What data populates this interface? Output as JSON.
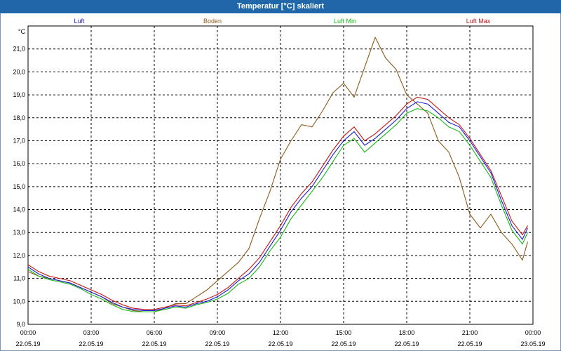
{
  "chart_data": {
    "type": "line",
    "title": "Temperatur [°C] skaliert",
    "ylabel": "°C",
    "ylim": [
      9.0,
      22.0
    ],
    "yticks": [
      {
        "value": 9.0,
        "label": "9,0"
      },
      {
        "value": 10.0,
        "label": "10,0"
      },
      {
        "value": 11.0,
        "label": "11,0"
      },
      {
        "value": 12.0,
        "label": "12,0"
      },
      {
        "value": 13.0,
        "label": "13,0"
      },
      {
        "value": 14.0,
        "label": "14,0"
      },
      {
        "value": 15.0,
        "label": "15,0"
      },
      {
        "value": 16.0,
        "label": "16,0"
      },
      {
        "value": 17.0,
        "label": "17,0"
      },
      {
        "value": 18.0,
        "label": "18,0"
      },
      {
        "value": 19.0,
        "label": "19,0"
      },
      {
        "value": 20.0,
        "label": "20,0"
      },
      {
        "value": 21.0,
        "label": "21,0"
      }
    ],
    "xlim": [
      0,
      24
    ],
    "xticks": [
      {
        "value": 0,
        "time": "00:00",
        "date": "22.05.19"
      },
      {
        "value": 3,
        "time": "03:00",
        "date": "22.05.19"
      },
      {
        "value": 6,
        "time": "06:00",
        "date": "22.05.19"
      },
      {
        "value": 9,
        "time": "09:00",
        "date": "22.05.19"
      },
      {
        "value": 12,
        "time": "12:00",
        "date": "22.05.19"
      },
      {
        "value": 15,
        "time": "15:00",
        "date": "22.05.19"
      },
      {
        "value": 18,
        "time": "18:00",
        "date": "22.05.19"
      },
      {
        "value": 21,
        "time": "21:00",
        "date": "22.05.19"
      },
      {
        "value": 24,
        "time": "00:00",
        "date": "23.05.19"
      }
    ],
    "grid": true,
    "legend_position": "top",
    "x": [
      0,
      0.5,
      1,
      1.5,
      2,
      2.5,
      3,
      3.5,
      4,
      4.5,
      5,
      5.5,
      6,
      6.5,
      7,
      7.5,
      8,
      8.5,
      9,
      9.5,
      10,
      10.5,
      11,
      11.5,
      12,
      12.5,
      13,
      13.5,
      14,
      14.5,
      15,
      15.5,
      16,
      16.5,
      17,
      17.5,
      18,
      18.5,
      19,
      19.5,
      20,
      20.5,
      21,
      21.5,
      22,
      22.5,
      23,
      23.5,
      23.75
    ],
    "series": [
      {
        "name": "Luft",
        "color": "#1a1ad8",
        "values": [
          11.5,
          11.2,
          11.0,
          10.9,
          10.8,
          10.6,
          10.4,
          10.2,
          9.95,
          9.75,
          9.65,
          9.6,
          9.6,
          9.7,
          9.8,
          9.75,
          9.9,
          10.0,
          10.2,
          10.5,
          10.9,
          11.2,
          11.7,
          12.4,
          13.1,
          13.9,
          14.5,
          15.0,
          15.7,
          16.4,
          17.0,
          17.4,
          16.8,
          17.1,
          17.5,
          17.9,
          18.4,
          18.7,
          18.6,
          18.2,
          17.8,
          17.6,
          17.0,
          16.3,
          15.6,
          14.4,
          13.3,
          12.7,
          13.2
        ]
      },
      {
        "name": "Boden",
        "color": "#8b5a1a",
        "values": [
          11.3,
          11.1,
          11.0,
          10.9,
          10.8,
          10.6,
          10.4,
          10.2,
          9.9,
          9.75,
          9.6,
          9.55,
          9.55,
          9.7,
          9.9,
          9.9,
          10.2,
          10.5,
          10.9,
          11.3,
          11.7,
          12.3,
          13.6,
          14.8,
          16.2,
          17.0,
          17.7,
          17.6,
          18.3,
          19.1,
          19.5,
          18.9,
          20.2,
          21.5,
          20.6,
          20.1,
          19.0,
          18.6,
          18.2,
          17.0,
          16.5,
          15.4,
          13.8,
          13.2,
          13.8,
          13.0,
          12.5,
          11.8,
          12.6
        ]
      },
      {
        "name": "Luft Min",
        "color": "#15b915",
        "values": [
          11.4,
          11.1,
          10.95,
          10.85,
          10.75,
          10.55,
          10.3,
          10.1,
          9.85,
          9.65,
          9.55,
          9.55,
          9.55,
          9.65,
          9.75,
          9.7,
          9.85,
          9.95,
          10.1,
          10.35,
          10.75,
          11.0,
          11.5,
          12.2,
          12.8,
          13.6,
          14.2,
          14.8,
          15.4,
          16.1,
          16.8,
          17.1,
          16.5,
          16.9,
          17.3,
          17.7,
          18.2,
          18.4,
          18.3,
          18.0,
          17.6,
          17.4,
          16.8,
          16.1,
          15.4,
          14.2,
          13.1,
          12.5,
          13.0
        ]
      },
      {
        "name": "Luft Max",
        "color": "#c01515",
        "values": [
          11.6,
          11.3,
          11.1,
          11.0,
          10.9,
          10.7,
          10.5,
          10.3,
          10.05,
          9.85,
          9.7,
          9.65,
          9.65,
          9.75,
          9.85,
          9.8,
          9.95,
          10.1,
          10.3,
          10.6,
          11.0,
          11.4,
          11.9,
          12.6,
          13.3,
          14.1,
          14.7,
          15.2,
          15.9,
          16.6,
          17.2,
          17.6,
          17.0,
          17.3,
          17.7,
          18.1,
          18.6,
          18.9,
          18.8,
          18.4,
          18.0,
          17.7,
          17.1,
          16.4,
          15.7,
          14.6,
          13.5,
          12.9,
          13.3
        ]
      }
    ]
  }
}
